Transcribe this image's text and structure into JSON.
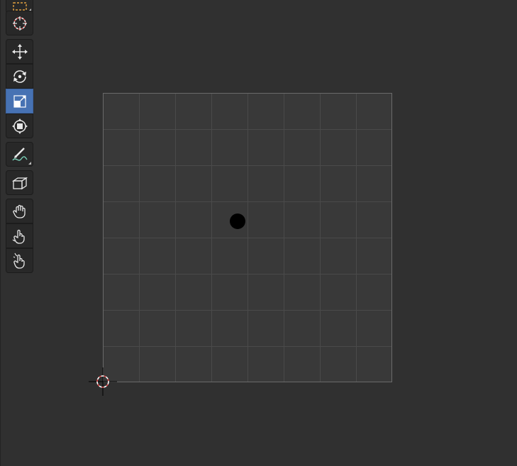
{
  "editor": {
    "type": "UV Editor",
    "theme": {
      "background": "#303030",
      "toolbar_button": "#282828",
      "toolbar_active": "#4772b3",
      "grid_fill": "#393939",
      "grid_line": "#4a4a4a",
      "grid_border": "#6a6a6a",
      "vertex": "#000000",
      "cursor_red": "#e04848"
    }
  },
  "toolbar": {
    "tools": [
      {
        "name": "select-box",
        "icon": "select-box-icon",
        "active": false
      },
      {
        "name": "cursor",
        "icon": "cursor-icon",
        "active": false
      },
      {
        "name": "move",
        "icon": "move-icon",
        "active": false
      },
      {
        "name": "rotate",
        "icon": "rotate-icon",
        "active": false
      },
      {
        "name": "scale",
        "icon": "scale-icon",
        "active": true
      },
      {
        "name": "transform",
        "icon": "transform-icon",
        "active": false
      },
      {
        "name": "annotate",
        "icon": "annotate-icon",
        "active": false
      },
      {
        "name": "grab",
        "icon": "grab-icon",
        "active": false
      },
      {
        "name": "relax",
        "icon": "relax-icon",
        "active": false
      },
      {
        "name": "pinch",
        "icon": "pinch-icon",
        "active": false
      },
      {
        "name": "uv-sculpt",
        "icon": "uv-sculpt-icon",
        "active": false
      }
    ]
  },
  "uv_grid": {
    "divisions": 8
  }
}
